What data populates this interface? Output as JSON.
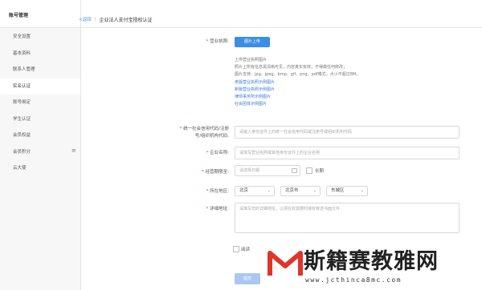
{
  "sidebar": {
    "title": "账号管理",
    "items": [
      {
        "label": "安全设置"
      },
      {
        "label": "基本资料"
      },
      {
        "label": "联系人管理"
      },
      {
        "label": "实名认证"
      },
      {
        "label": "账号绑定"
      },
      {
        "label": "学生认证"
      },
      {
        "label": "会员权益"
      },
      {
        "label": "会员积分"
      },
      {
        "label": "云大使"
      }
    ],
    "active_index": 3,
    "collapse_icon": "≡"
  },
  "topbar": {
    "back_label": "<返回",
    "separator": "|",
    "title": "企业法人支付宝授权认证"
  },
  "form": {
    "license": {
      "label": "营业执照:",
      "button": "图片上传",
      "hints": [
        "上传营业执照图片",
        "照片上所有信息需清晰可见，内容真实有效，不得做任何修改；",
        "图片支持：jpg、jpeg、bmp、gif、png、pdf格式，大小不超过8M。"
      ],
      "example_links": [
        "老版营业执照示例图片",
        "新版营业执照示例图片",
        "律师事务所示例图片",
        "社会团体示例图片"
      ]
    },
    "credit_code": {
      "label_line1": "统一社会信用代码/注册",
      "label_line2": "号/组织机构代码:",
      "placeholder": "请输入身份证件上的统一社会信用代码或注册号或组织机构代码"
    },
    "company_name": {
      "label": "企业名称:",
      "placeholder": "请填写营业执照或其他身份证件上的企业名称"
    },
    "term": {
      "label": "经营期限至:",
      "date_placeholder": "请选择日期",
      "longterm_label": "长期"
    },
    "region": {
      "label": "所在地区:",
      "province": "北京",
      "city": "北京市",
      "district": "东城区"
    },
    "address": {
      "label": "详细地址:",
      "placeholder": "请填写您的详细地址，以便在有需要时接收寄送书面文件"
    },
    "agreement_label": "阅读",
    "submit_label": "提交"
  },
  "watermark": {
    "text": "斯籍赛教雅网",
    "url": "www.jcthinca8mc.com"
  },
  "colors": {
    "accent": "#3a8ee6",
    "link": "#3a7bd5",
    "required": "#e33333",
    "watermark_red": "#e0342b"
  }
}
